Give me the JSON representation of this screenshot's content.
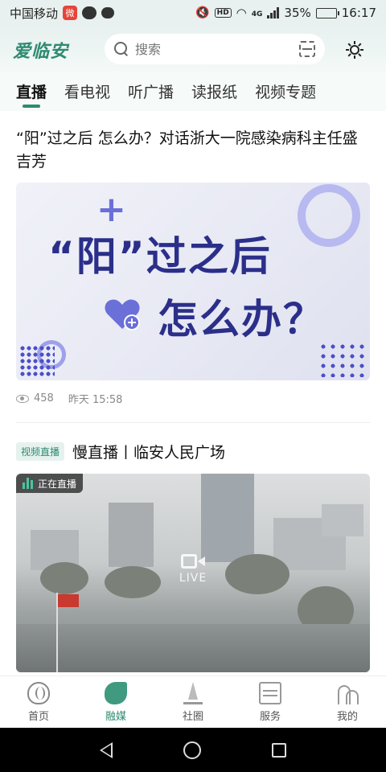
{
  "status_bar": {
    "carrier": "中国移动",
    "app_badge": "微",
    "network_label": "4G",
    "battery": "35%",
    "battery_level": 0.35,
    "time": "16:17"
  },
  "header": {
    "logo_text": "爱临安",
    "search_placeholder": "搜索"
  },
  "tabs": [
    {
      "label": "直播",
      "active": true
    },
    {
      "label": "看电视",
      "active": false
    },
    {
      "label": "听广播",
      "active": false
    },
    {
      "label": "读报纸",
      "active": false
    },
    {
      "label": "视频专题",
      "active": false
    }
  ],
  "articles": [
    {
      "title": "“阳”过之后 怎么办？对话浙大一院感染病科主任盛吉芳",
      "image": {
        "line1": "“阳”过之后",
        "line2": "怎么办？"
      },
      "views": "458",
      "time": "昨天 15:58"
    },
    {
      "badge": "视频直播",
      "title": "慢直播丨临安人民广场",
      "live_badge": "正在直播",
      "overlay_text": "LIVE"
    }
  ],
  "bottom_nav": [
    {
      "label": "首页",
      "icon": "home-icon",
      "active": false
    },
    {
      "label": "融媒",
      "icon": "media-icon",
      "active": true
    },
    {
      "label": "社圈",
      "icon": "community-icon",
      "active": false
    },
    {
      "label": "服务",
      "icon": "service-icon",
      "active": false
    },
    {
      "label": "我的",
      "icon": "profile-icon",
      "active": false
    }
  ],
  "colors": {
    "accent": "#2e8a70",
    "image_text": "#2b2f8a",
    "image_accent": "#6b6fd8"
  }
}
